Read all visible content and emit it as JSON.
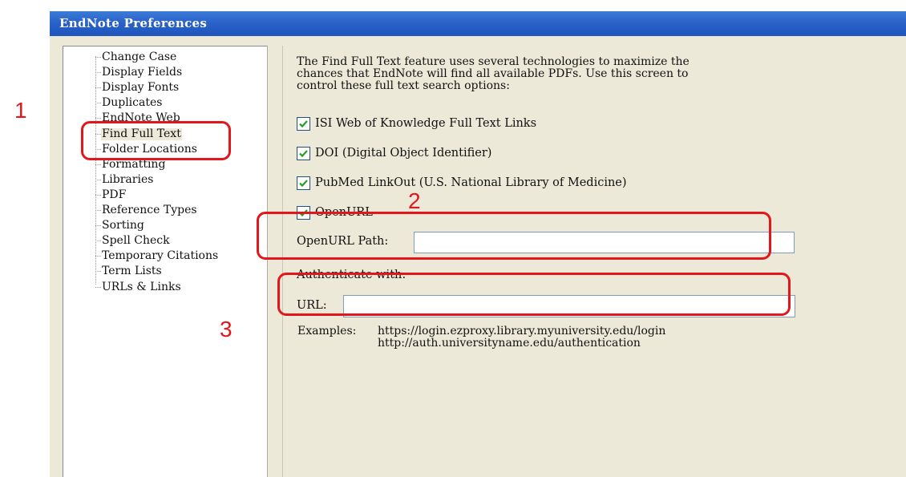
{
  "window": {
    "title": "EndNote Preferences"
  },
  "sidebar": {
    "items": [
      {
        "label": "Change Case"
      },
      {
        "label": "Display Fields"
      },
      {
        "label": "Display Fonts"
      },
      {
        "label": "Duplicates"
      },
      {
        "label": "EndNote Web"
      },
      {
        "label": "Find Full Text",
        "selected": true
      },
      {
        "label": "Folder Locations"
      },
      {
        "label": "Formatting"
      },
      {
        "label": "Libraries"
      },
      {
        "label": "PDF"
      },
      {
        "label": "Reference Types"
      },
      {
        "label": "Sorting"
      },
      {
        "label": "Spell Check"
      },
      {
        "label": "Temporary Citations"
      },
      {
        "label": "Term Lists"
      },
      {
        "label": "URLs & Links"
      }
    ]
  },
  "main": {
    "intro_lines": [
      "The Find Full Text feature uses several technologies to maximize the",
      "chances that EndNote will find all available PDFs. Use this screen to",
      "control these full text search options:"
    ],
    "options": [
      {
        "label": "ISI Web of Knowledge Full Text Links",
        "checked": true
      },
      {
        "label": "DOI (Digital Object Identifier)",
        "checked": true
      },
      {
        "label": "PubMed LinkOut (U.S. National Library of Medicine)",
        "checked": true
      },
      {
        "label": "OpenURL",
        "checked": true
      }
    ],
    "openurl_path": {
      "label": "OpenURL Path:",
      "value": ""
    },
    "authenticate_label": "Authenticate with:",
    "url_field": {
      "label": "URL:",
      "value": ""
    },
    "examples": {
      "label": "Examples:",
      "urls": [
        "https://login.ezproxy.library.myuniversity.edu/login",
        "http://auth.universityname.edu/authentication"
      ]
    }
  },
  "annotations": {
    "numbers": [
      "1",
      "2",
      "3"
    ],
    "color": "#e3171b"
  },
  "colors": {
    "titlebar": "#2a62c9",
    "dialog_bg": "#ece9d8",
    "checkbox_border": "#1c5180",
    "check_mark": "#21a121"
  }
}
